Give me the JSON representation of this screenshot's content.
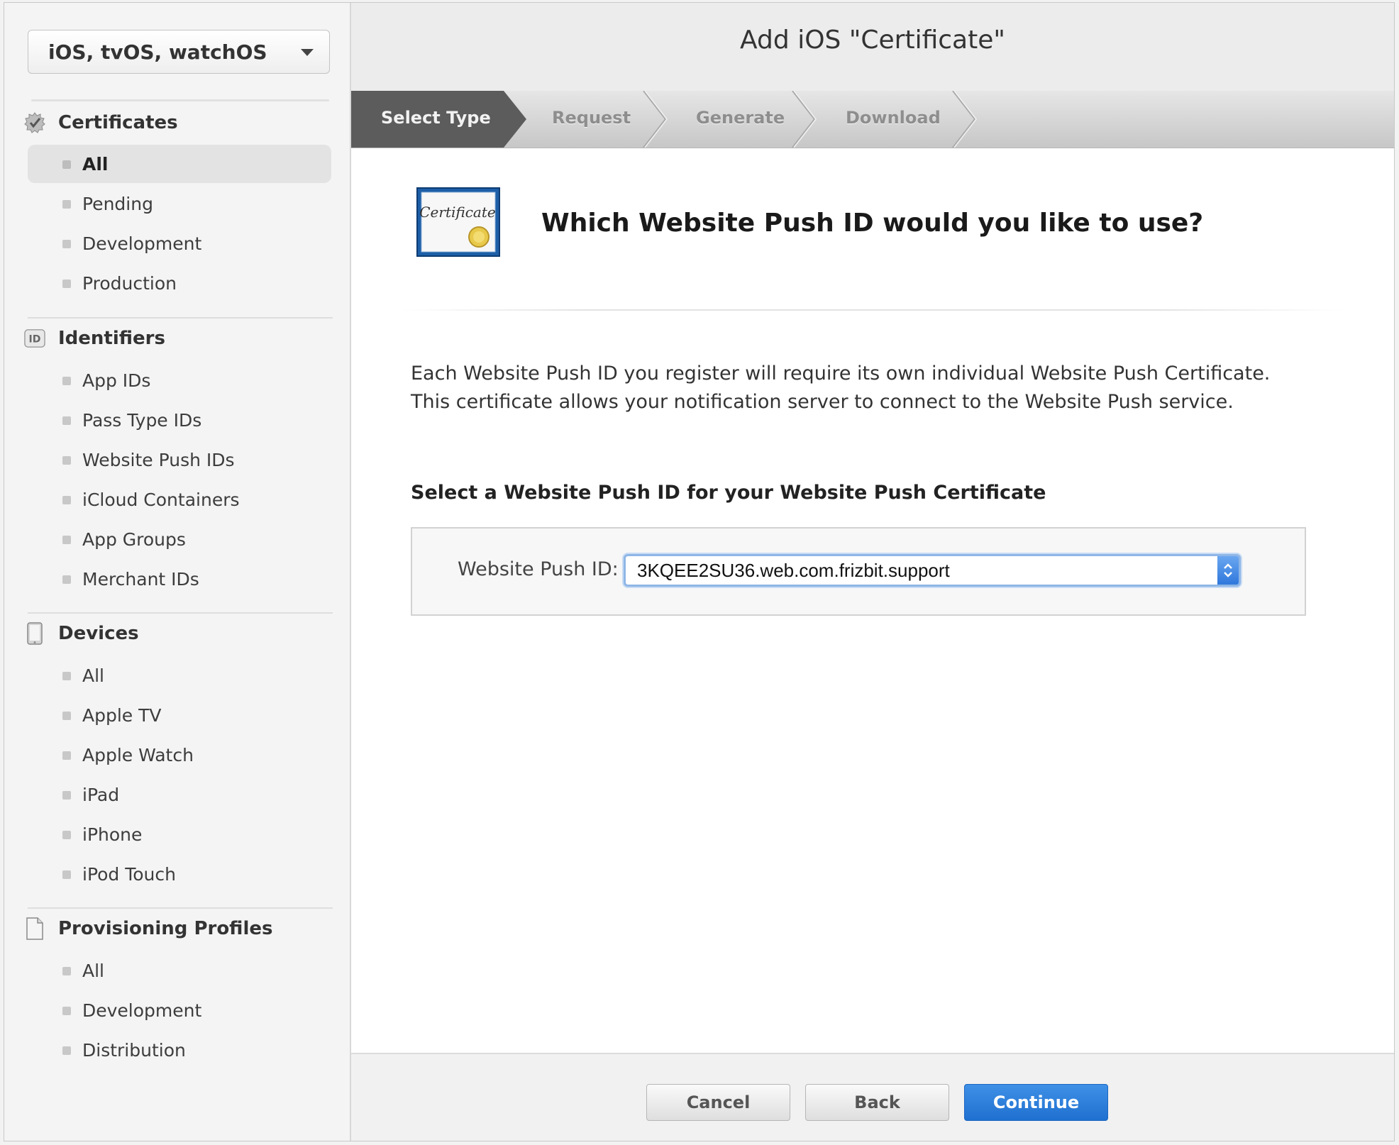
{
  "sidebar": {
    "platform_select": "iOS, tvOS, watchOS",
    "sections": [
      {
        "title": "Certificates",
        "icon": "certificate-seal-icon",
        "items": [
          {
            "label": "All",
            "active": true
          },
          {
            "label": "Pending"
          },
          {
            "label": "Development"
          },
          {
            "label": "Production"
          }
        ]
      },
      {
        "title": "Identifiers",
        "icon": "id-badge-icon",
        "icon_text": "ID",
        "items": [
          {
            "label": "App IDs"
          },
          {
            "label": "Pass Type IDs"
          },
          {
            "label": "Website Push IDs"
          },
          {
            "label": "iCloud Containers"
          },
          {
            "label": "App Groups"
          },
          {
            "label": "Merchant IDs"
          }
        ]
      },
      {
        "title": "Devices",
        "icon": "device-icon",
        "items": [
          {
            "label": "All"
          },
          {
            "label": "Apple TV"
          },
          {
            "label": "Apple Watch"
          },
          {
            "label": "iPad"
          },
          {
            "label": "iPhone"
          },
          {
            "label": "iPod Touch"
          }
        ]
      },
      {
        "title": "Provisioning Profiles",
        "icon": "document-icon",
        "items": [
          {
            "label": "All"
          },
          {
            "label": "Development"
          },
          {
            "label": "Distribution"
          }
        ]
      }
    ]
  },
  "header": {
    "title": "Add iOS \"Certificate\""
  },
  "steps": [
    {
      "label": "Select Type",
      "active": true
    },
    {
      "label": "Request"
    },
    {
      "label": "Generate"
    },
    {
      "label": "Download"
    }
  ],
  "content": {
    "cert_icon_text": "Certificate",
    "question": "Which Website Push ID would you like to use?",
    "description": "Each Website Push ID you register will require its own individual Website Push Certificate. This certificate allows your notification server to connect to the Website Push service.",
    "select_heading": "Select a Website Push ID for your Website Push Certificate",
    "field_label": "Website Push ID:",
    "field_value": "3KQEE2SU36.web.com.frizbit.support"
  },
  "footer": {
    "cancel": "Cancel",
    "back": "Back",
    "continue": "Continue"
  },
  "colors": {
    "accent": "#2a7ad9",
    "active_step": "#5b5b5b"
  }
}
